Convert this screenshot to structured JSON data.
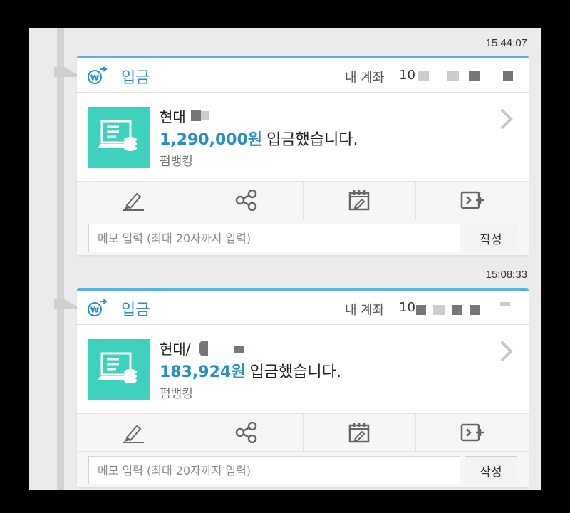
{
  "colors": {
    "accent_blue": "#2a8fc9",
    "card_top_border": "#56b3e6",
    "bank_tile": "#3ed1be"
  },
  "notifications": [
    {
      "timestamp": "15:44:07",
      "title": "입금",
      "account_label": "내 계좌",
      "account_number_visible": "10",
      "bank_name": "현대",
      "amount": "1,290,000원",
      "message": "입금했습니다.",
      "source": "펌뱅킹",
      "memo_placeholder": "메모 입력 (최대 20자까지 입력)",
      "write_button": "작성",
      "actions": [
        "highlighter-icon",
        "share-icon",
        "calendar-icon",
        "transfer-icon"
      ]
    },
    {
      "timestamp": "15:08:33",
      "title": "입금",
      "account_label": "내 계좌",
      "account_number_visible": "10",
      "bank_name": "현대/",
      "amount": "183,924원",
      "message": "입금했습니다.",
      "source": "펌뱅킹",
      "memo_placeholder": "메모 입력 (최대 20자까지 입력)",
      "write_button": "작성",
      "actions": [
        "highlighter-icon",
        "share-icon",
        "calendar-icon",
        "transfer-icon"
      ]
    }
  ]
}
